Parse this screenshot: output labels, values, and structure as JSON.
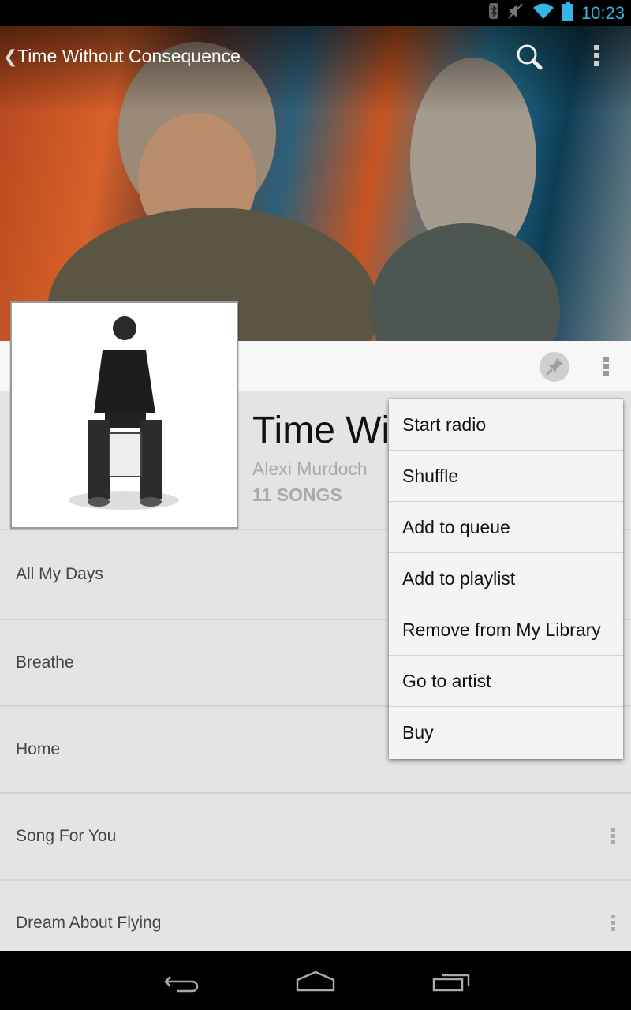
{
  "status_bar": {
    "time": "10:23",
    "icons": [
      "bluetooth-icon",
      "mute-icon",
      "wifi-icon",
      "battery-icon"
    ],
    "clock_color": "#33b5e5"
  },
  "action_bar": {
    "title": "Time Without Consequence",
    "back_glyph": "❮",
    "icons": [
      "search-icon",
      "overflow-menu-icon"
    ]
  },
  "album": {
    "title": "Time Without Consequence",
    "title_visible": "Time Wi",
    "artist": "Alexi Murdoch",
    "song_count": "11 SONGS",
    "header_icons": [
      "pin-icon",
      "overflow-menu-icon"
    ]
  },
  "songs": [
    {
      "title": "All My Days",
      "has_overflow": false
    },
    {
      "title": "Breathe",
      "has_overflow": false
    },
    {
      "title": "Home",
      "has_overflow": false
    },
    {
      "title": "Song For You",
      "has_overflow": true
    },
    {
      "title": "Dream About Flying",
      "has_overflow": true
    }
  ],
  "popup_menu": {
    "items": [
      {
        "label": "Start radio"
      },
      {
        "label": "Shuffle"
      },
      {
        "label": "Add to queue"
      },
      {
        "label": "Add to playlist"
      },
      {
        "label": "Remove from My Library"
      },
      {
        "label": "Go to artist"
      },
      {
        "label": "Buy"
      }
    ]
  },
  "nav_bar": {
    "buttons": [
      "back-icon",
      "home-icon",
      "recent-apps-icon"
    ]
  }
}
